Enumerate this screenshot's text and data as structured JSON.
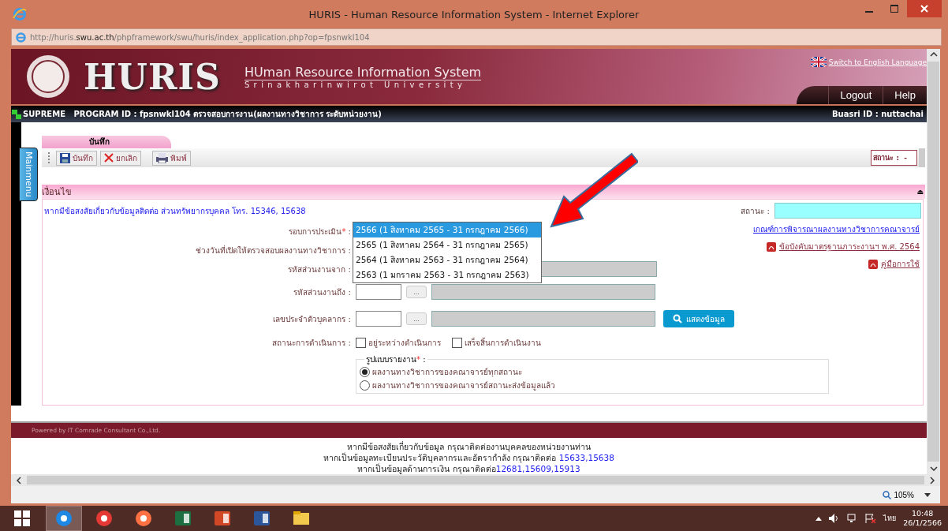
{
  "window": {
    "title": "HURIS - Human Resource Information System - Internet Explorer"
  },
  "address_bar": {
    "prefix": "http://huris.",
    "domain": "swu.ac.th",
    "path": "/phpframework/swu/huris/index_application.php?op=fpsnwkl104"
  },
  "header": {
    "logo_text": "HURIS",
    "system_name": "HUman Resource Information System",
    "university": "Srinakharinwirot University",
    "language_link": "Switch to English Language",
    "nav": [
      "Logout",
      "Help"
    ]
  },
  "program_bar": {
    "program": "SUPREME   PROGRAM ID : fpsnwkl104 ตรวจสอบการงาน(ผลงานทางวิชาการ ระดับหน่วยงาน)",
    "user": "Buasri ID : nuttachai"
  },
  "side_tab": "Mainmenu",
  "page_tab": "บันทึก",
  "toolbar": [
    {
      "label": "บันทึก",
      "kind": "save",
      "disabled": false
    },
    {
      "label": "ยกเลิก",
      "kind": "cancel",
      "disabled": false
    },
    {
      "label": "พิมพ์",
      "kind": "print",
      "disabled": false
    }
  ],
  "toolbar_status": "สถานะ :  -",
  "section": {
    "title": "เงื่อนไข",
    "collapse_icon": "⏏"
  },
  "contact_note": "หากมีข้อสงสัยเกี่ยวกับข้อมูลติดต่อ ส่วนทรัพยากรบุคคล โทร. 15346, 15638",
  "status_field": {
    "label": "สถานะ :"
  },
  "links": [
    {
      "label": "เกณฑ์การพิจารณาผลงานทางวิชาการคณาจารย์",
      "pdf": false
    },
    {
      "label": "ข้อบังคับมาตรฐานภาระงานฯ พ.ศ. 2564",
      "pdf": true
    },
    {
      "label": "คู่มือการใช้",
      "pdf": true
    }
  ],
  "round": {
    "label": "รอบการประเมิน",
    "required_mark": "*",
    "colon": ":",
    "options": [
      {
        "label": "2566 (1 สิงหาคม 2565 - 31 กรกฎาคม 2566)",
        "selected": true
      },
      {
        "label": "2565 (1 สิงหาคม 2564 - 31 กรกฎาคม 2565)",
        "selected": false
      },
      {
        "label": "2564 (1 สิงหาคม 2563 - 31 กรกฎาคม 2564)",
        "selected": false
      },
      {
        "label": "2563 (1 มกราคม 2563 - 31 กรกฎาคม 2563)",
        "selected": false
      }
    ]
  },
  "date_range_label": "ช่วงวันที่เปิดให้ตรวจสอบผลงานทางวิชาการ :",
  "lookup_rows": [
    {
      "label": "รหัสส่วนงานจาก :",
      "show_button": false
    },
    {
      "label": "รหัสส่วนงานถึง :",
      "lookup_button": "...",
      "show_button": false
    },
    {
      "label": "เลขประจำตัวบุคลากร :",
      "lookup_button": "...",
      "show_button": true
    }
  ],
  "show_button": "แสดงข้อมูล",
  "progress": {
    "label": "สถานะการดำเนินการ :",
    "options": [
      {
        "label": "อยู่ระหว่างดำเนินการ",
        "checked": false
      },
      {
        "label": "เสร็จสิ้นการดำเนินงาน",
        "checked": false
      }
    ]
  },
  "report_format": {
    "legend": "รูปแบบรายงาน",
    "required_mark": "*",
    "colon": ":",
    "options": [
      {
        "label": "ผลงานทางวิชาการของคณาจารย์ทุกสถานะ",
        "selected": true
      },
      {
        "label": "ผลงานทางวิชาการของคณาจารย์สถานะส่งข้อมูลแล้ว",
        "selected": false
      }
    ]
  },
  "powered_by": "Powered by IT Comrade Consultant Co.,Ltd.",
  "footer_lines": [
    {
      "text": "หากมีข้อสงสัยเกี่ยวกับข้อมูล กรุณาติดต่องานบุคคลของหน่วยงานท่าน"
    },
    {
      "text": "หากเป็นข้อมูลทะเบียนประวัติบุคลากรและอัตรากำลัง กรุณาติดต่อ ",
      "phone": "15633,15638"
    },
    {
      "text": "หากเป็นข้อมูลด้านการเงิน กรุณาติดต่อ",
      "phone": "12681,15609,15913"
    }
  ],
  "status_bar": {
    "zoom": "105%"
  },
  "taskbar": {
    "apps": [
      {
        "kind": "ie",
        "selected": true
      },
      {
        "kind": "chrome",
        "selected": false
      },
      {
        "kind": "firefox",
        "selected": false
      },
      {
        "kind": "excel",
        "selected": false
      },
      {
        "kind": "powerpoint",
        "selected": false
      },
      {
        "kind": "word",
        "selected": false
      },
      {
        "kind": "explorer",
        "selected": false
      }
    ],
    "language": "ไทย",
    "time": "10:48",
    "date": "26/1/2566"
  }
}
